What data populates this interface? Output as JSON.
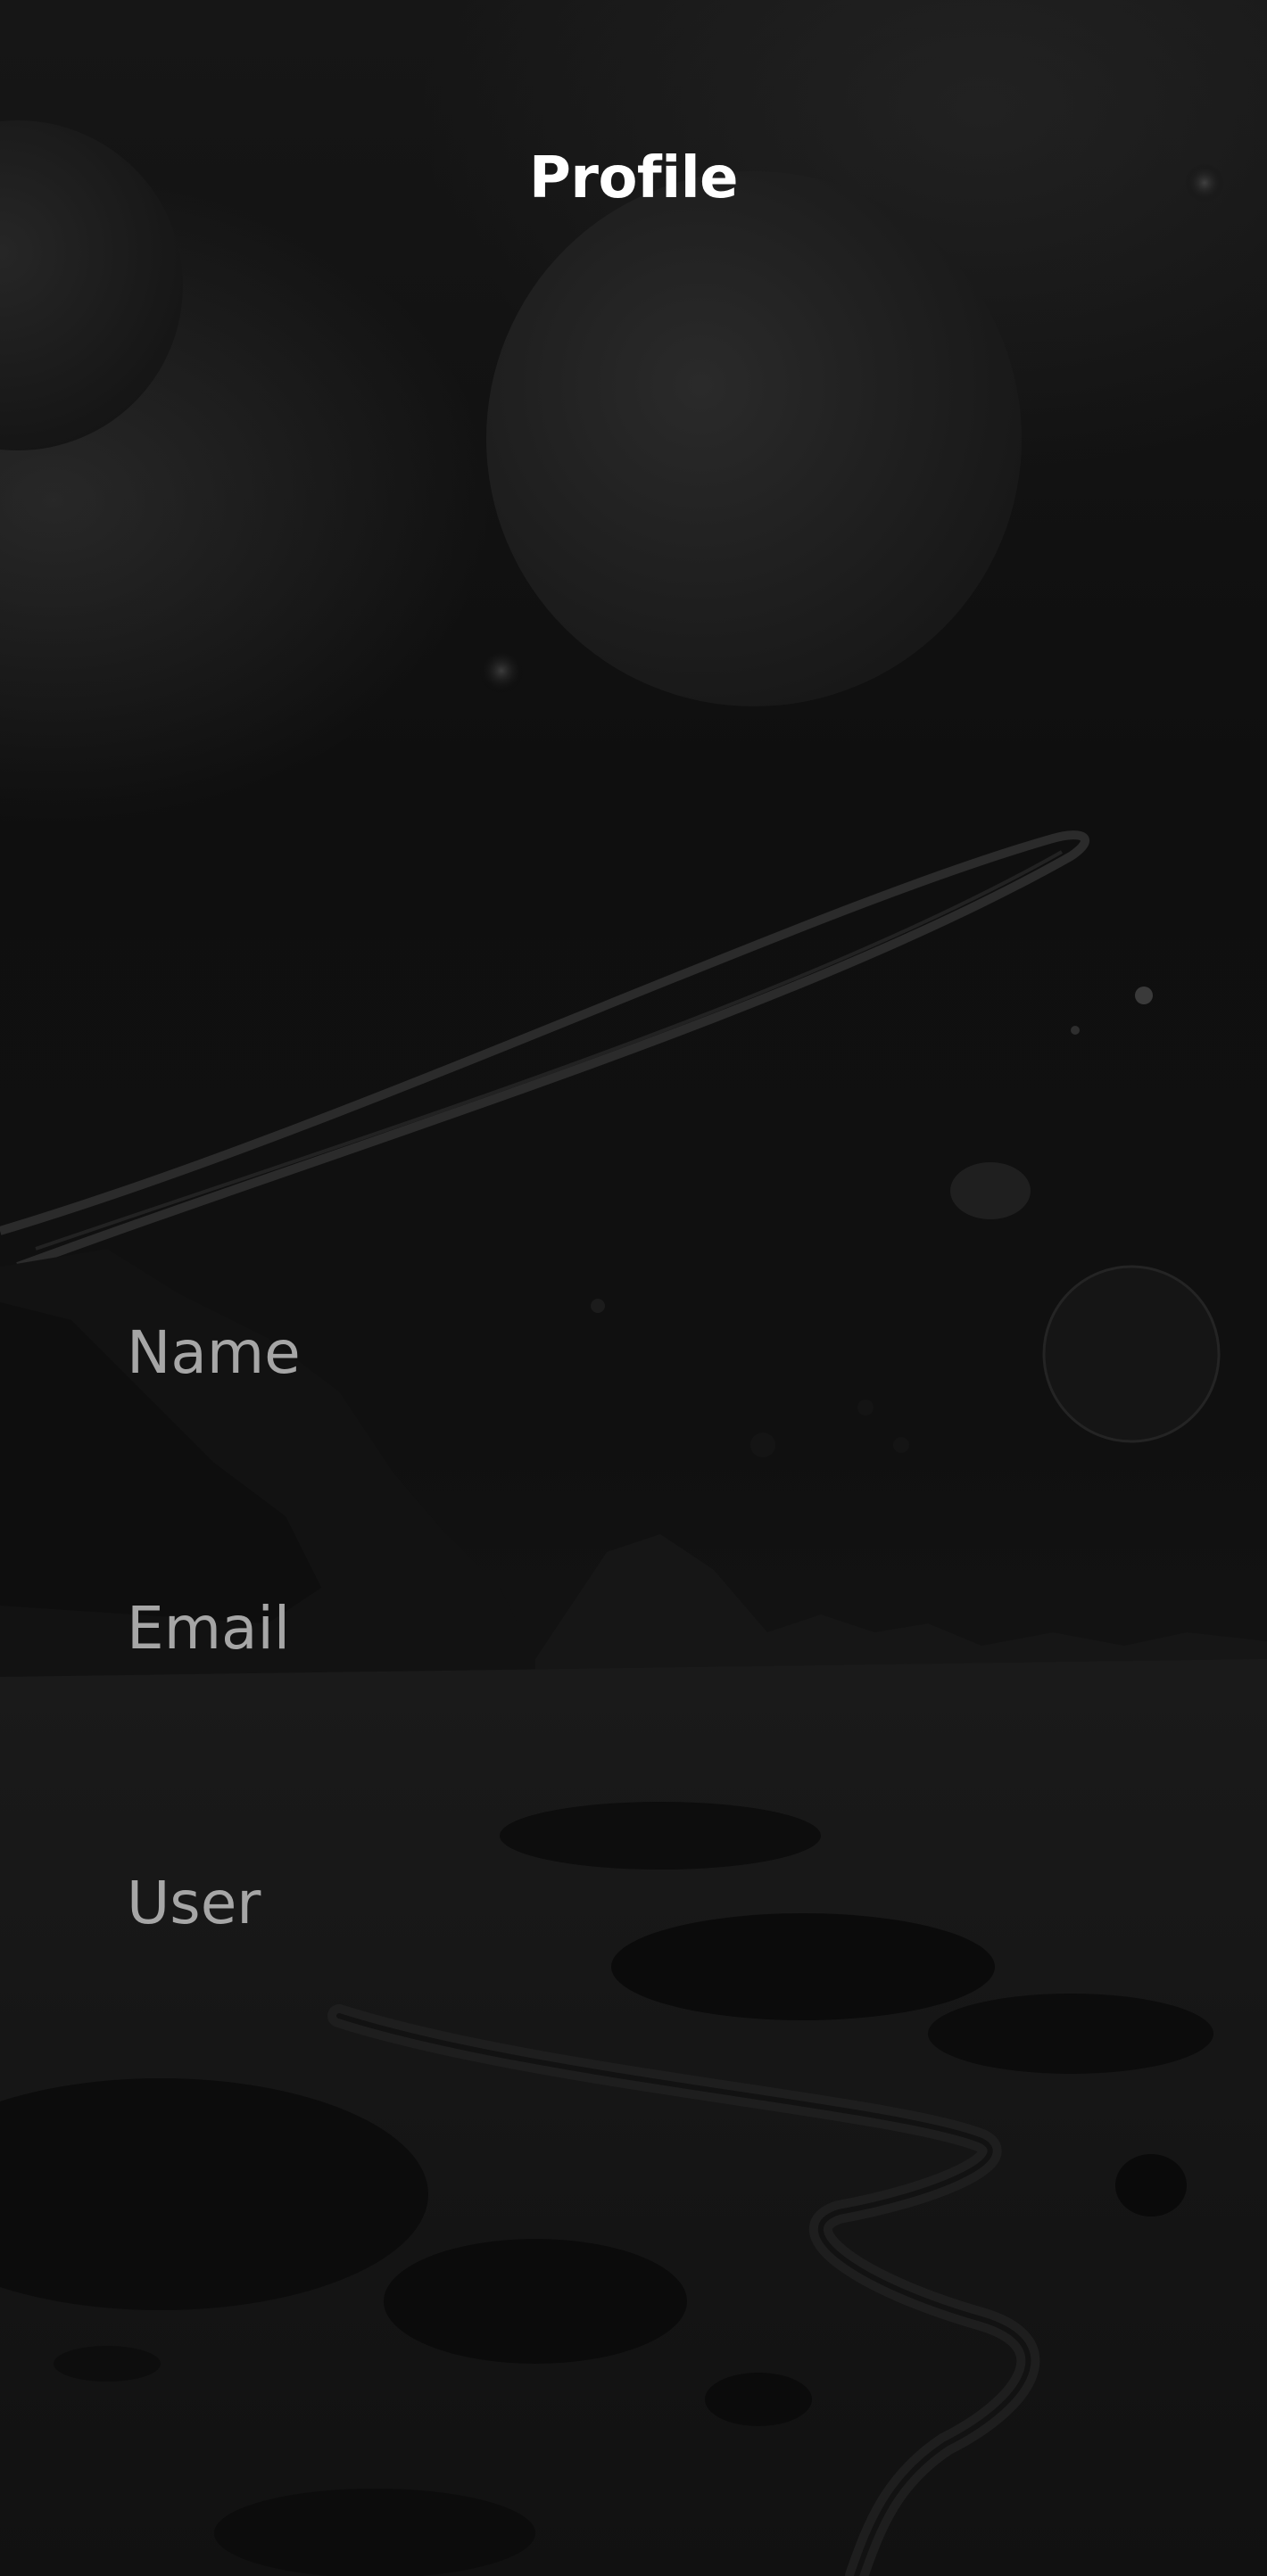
{
  "header": {
    "title": "Profile"
  },
  "profile_fields": [
    {
      "label": "Name"
    },
    {
      "label": "Email"
    },
    {
      "label": "User"
    }
  ],
  "theme": {
    "background": "#0f0f0f",
    "title_color": "#ffffff",
    "label_color": "#a6a6a6"
  },
  "background_scene": "space-landscape-image"
}
